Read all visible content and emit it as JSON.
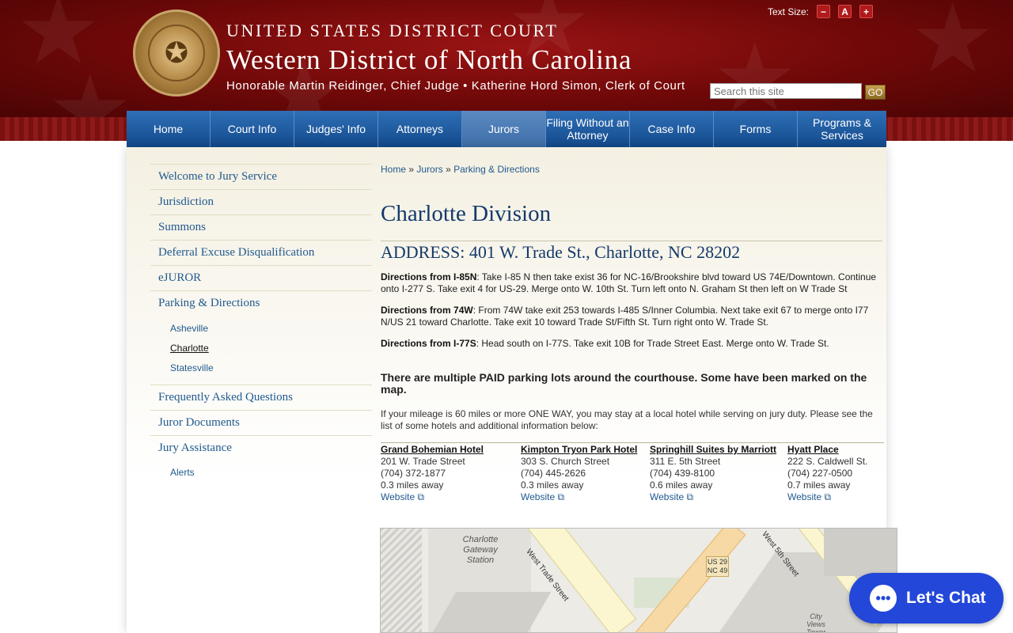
{
  "header": {
    "court_line1": "UNITED STATES DISTRICT COURT",
    "court_line2": "Western District of North Carolina",
    "court_line3": "Honorable Martin Reidinger, Chief Judge • Katherine Hord Simon, Clerk of Court",
    "text_size_label": "Text Size:",
    "text_size_buttons": [
      "−",
      "A",
      "+"
    ],
    "search_placeholder": "Search this site",
    "search_button": "GO",
    "seal_icon": "eagle-seal-icon"
  },
  "nav": {
    "items": [
      {
        "label": "Home"
      },
      {
        "label": "Court Info"
      },
      {
        "label": "Judges' Info"
      },
      {
        "label": "Attorneys"
      },
      {
        "label": "Jurors"
      },
      {
        "label": "Filing Without an Attorney"
      },
      {
        "label": "Case Info"
      },
      {
        "label": "Forms"
      },
      {
        "label": "Programs & Services"
      }
    ],
    "active": "Jurors"
  },
  "sidebar": {
    "items": [
      {
        "label": "Welcome to Jury Service"
      },
      {
        "label": "Jurisdiction"
      },
      {
        "label": "Summons"
      },
      {
        "label": "Deferral Excuse Disqualification"
      },
      {
        "label": "eJUROR"
      },
      {
        "label": "Parking & Directions"
      },
      {
        "label": "Frequently Asked Questions"
      },
      {
        "label": "Juror Documents"
      },
      {
        "label": "Jury Assistance"
      }
    ],
    "parking_sub": [
      "Asheville",
      "Charlotte",
      "Statesville"
    ],
    "assistance_sub": [
      "Alerts"
    ],
    "current": "Charlotte"
  },
  "breadcrumb": {
    "items": [
      "Home",
      "Jurors",
      "Parking & Directions"
    ],
    "separator": "»"
  },
  "main": {
    "title": "Charlotte Division",
    "address": "ADDRESS:  401 W. Trade St., Charlotte, NC 28202",
    "directions": [
      {
        "label": "Directions from I-85N",
        "text": ": Take I-85 N then take exist 36 for NC-16/Brookshire blvd toward US 74E/Downtown.  Continue onto I-277 S.  Take exit 4 for US-29.  Merge onto W. 10th St.  Turn left onto N. Graham St then left on W Trade St"
      },
      {
        "label": "Directions from 74W",
        "text": ": From 74W take exit 253 towards I-485 S/Inner Columbia.  Next take exit 67 to merge onto I77 N/US 21 toward Charlotte.  Take exit 10 toward Trade St/Fifth St.  Turn right onto W. Trade St."
      },
      {
        "label": "Directions from I-77S",
        "text": ": Head south on I-77S.  Take exit 10B for Trade Street East.  Merge onto W. Trade St."
      }
    ],
    "parking_note": "There are multiple PAID parking lots around the courthouse.  Some have been marked on the map.",
    "mileage_note": "If your mileage is 60 miles or more ONE WAY, you may stay at a local hotel while serving on jury duty. Please see the list of some hotels and additional information below:",
    "hotels": [
      {
        "name": "Grand Bohemian Hotel",
        "address": "201 W. Trade Street",
        "phone": "(704) 372-1877",
        "distance": "0.3 miles away",
        "link": "Website"
      },
      {
        "name": "Kimpton Tryon Park Hotel",
        "address": "303 S. Church Street",
        "phone": "(704) 445-2626",
        "distance": "0.3 miles away",
        "link": "Website"
      },
      {
        "name": "Springhill Suites by Marriott",
        "address": "311 E. 5th Street",
        "phone": "(704) 439-8100",
        "distance": "0.6 miles away",
        "link": "Website"
      },
      {
        "name": "Hyatt Place ",
        "address": "222 S. Caldwell St.",
        "phone": "(704) 227-0500",
        "distance": "0.7 miles away",
        "link": "Website"
      }
    ],
    "external_link_icon": "external-link-icon"
  },
  "map": {
    "station_label": "Charlotte Gateway Station",
    "road1": "West Trade Street",
    "road2": "West 5th Street",
    "shield_line1": "US 29",
    "shield_line2": "NC 49",
    "area_label": "City Views Tower"
  },
  "chat": {
    "label": "Let's Chat",
    "icon": "chat-bubble-icon",
    "color": "#2347d8"
  }
}
